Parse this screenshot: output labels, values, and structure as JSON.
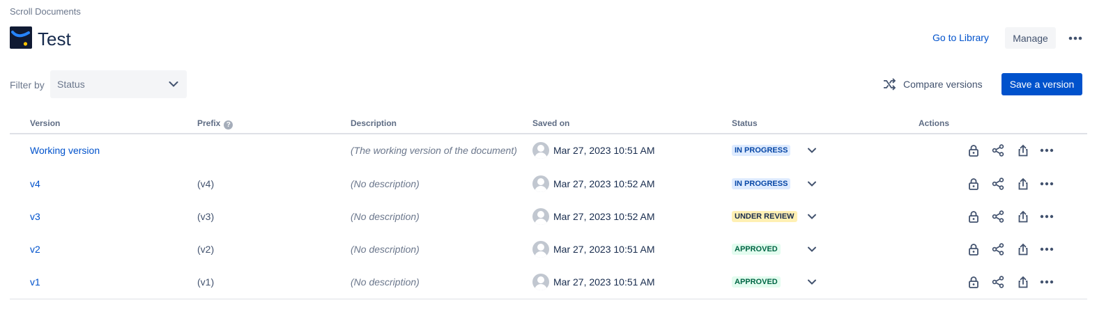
{
  "breadcrumb": "Scroll Documents",
  "page_title": "Test",
  "header": {
    "library_link": "Go to Library",
    "manage_label": "Manage"
  },
  "filter": {
    "label": "Filter by",
    "placeholder": "Status"
  },
  "toolbar": {
    "compare_label": "Compare versions",
    "save_label": "Save a version"
  },
  "columns": {
    "version": "Version",
    "prefix": "Prefix",
    "description": "Description",
    "saved_on": "Saved on",
    "status": "Status",
    "actions": "Actions"
  },
  "rows": [
    {
      "version": "Working version",
      "prefix": "",
      "description": "(The working version of the document)",
      "saved_on": "Mar 27, 2023 10:51 AM",
      "status": "IN PROGRESS",
      "status_fg": "#0747a6",
      "status_bg": "#deebff"
    },
    {
      "version": "v4",
      "prefix": "(v4)",
      "description": "(No description)",
      "saved_on": "Mar 27, 2023 10:52 AM",
      "status": "IN PROGRESS",
      "status_fg": "#0747a6",
      "status_bg": "#deebff"
    },
    {
      "version": "v3",
      "prefix": "(v3)",
      "description": "(No description)",
      "saved_on": "Mar 27, 2023 10:52 AM",
      "status": "UNDER REVIEW",
      "status_fg": "#172b4d",
      "status_bg": "#fff0b3"
    },
    {
      "version": "v2",
      "prefix": "(v2)",
      "description": "(No description)",
      "saved_on": "Mar 27, 2023 10:51 AM",
      "status": "APPROVED",
      "status_fg": "#006644",
      "status_bg": "#e3fcef"
    },
    {
      "version": "v1",
      "prefix": "(v1)",
      "description": "(No description)",
      "saved_on": "Mar 27, 2023 10:51 AM",
      "status": "APPROVED",
      "status_fg": "#006644",
      "status_bg": "#e3fcef"
    }
  ],
  "icons": {
    "logo": "scroll-documents-logo",
    "help": "question-icon",
    "compare": "shuffle-icon",
    "row_actions": [
      "lock-icon",
      "share-icon",
      "export-icon",
      "more-icon"
    ]
  },
  "colors": {
    "primary": "#0052cc",
    "text": "#172b4d",
    "subtle": "#6b778c"
  }
}
